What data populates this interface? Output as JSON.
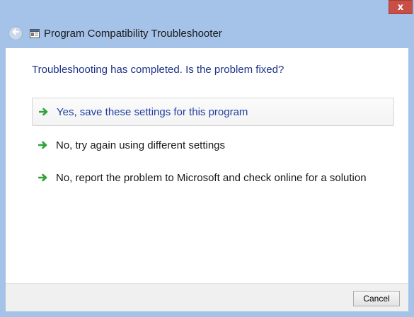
{
  "window": {
    "title": "Program Compatibility Troubleshooter",
    "close_glyph": "x"
  },
  "main": {
    "question": "Troubleshooting has completed.  Is the problem fixed?",
    "options": [
      {
        "label": "Yes, save these settings for this program",
        "icon": "green-arrow-icon"
      },
      {
        "label": "No, try again using different settings",
        "icon": "green-arrow-icon"
      },
      {
        "label": "No, report the problem to Microsoft and check online for a solution",
        "icon": "green-arrow-icon"
      }
    ]
  },
  "footer": {
    "cancel_label": "Cancel"
  },
  "colors": {
    "frame": "#a5c3e8",
    "heading": "#1e3287",
    "link": "#1f3fa0",
    "close": "#c74f48",
    "arrow": "#2fa33a"
  }
}
